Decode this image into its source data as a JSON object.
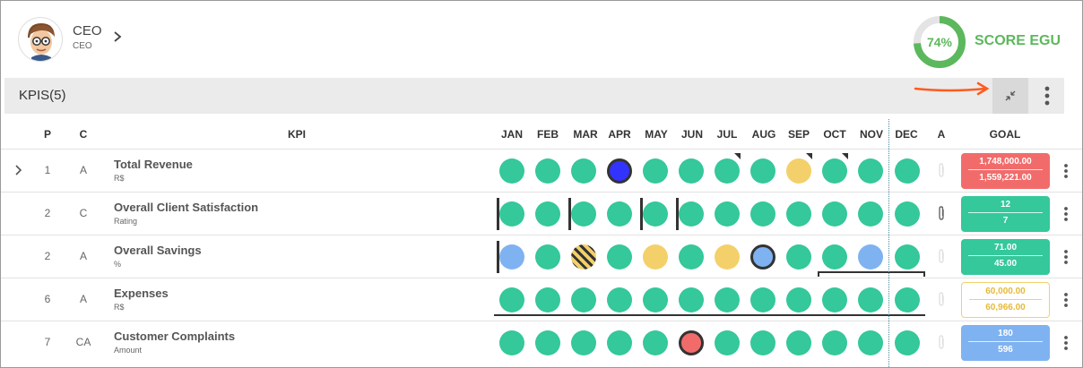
{
  "header": {
    "user_name": "CEO",
    "user_role": "CEO",
    "score_percent": "74%",
    "score_value": 0.74,
    "score_label": "SCORE EGU",
    "score_color": "#5cb85c"
  },
  "section": {
    "title": "KPIS(5)"
  },
  "columns": {
    "p": "P",
    "c": "C",
    "kpi": "KPI",
    "months": [
      "JAN",
      "FEB",
      "MAR",
      "APR",
      "MAY",
      "JUN",
      "JUL",
      "AUG",
      "SEP",
      "OCT",
      "NOV",
      "DEC"
    ],
    "a": "A",
    "goal": "GOAL"
  },
  "rows": [
    {
      "p": "1",
      "c": "A",
      "name": "Total Revenue",
      "unit": "R$",
      "goal_target": "1,748,000.00",
      "goal_actual": "1,559,221.00"
    },
    {
      "p": "2",
      "c": "C",
      "name": "Overall Client Satisfaction",
      "unit": "Rating",
      "goal_target": "12",
      "goal_actual": "7"
    },
    {
      "p": "2",
      "c": "A",
      "name": "Overall Savings",
      "unit": "%",
      "goal_target": "71.00",
      "goal_actual": "45.00"
    },
    {
      "p": "6",
      "c": "A",
      "name": "Expenses",
      "unit": "R$",
      "goal_target": "60,000.00",
      "goal_actual": "60,966.00"
    },
    {
      "p": "7",
      "c": "CA",
      "name": "Customer Complaints",
      "unit": "Amount",
      "goal_target": "180",
      "goal_actual": "596"
    }
  ],
  "colors": {
    "green": "#34c89a",
    "yellow": "#f4d06a",
    "red": "#f26b6b",
    "light_blue": "#7fb2f0",
    "blue": "#3333ff",
    "annotation_arrow": "#ff5a1f"
  }
}
